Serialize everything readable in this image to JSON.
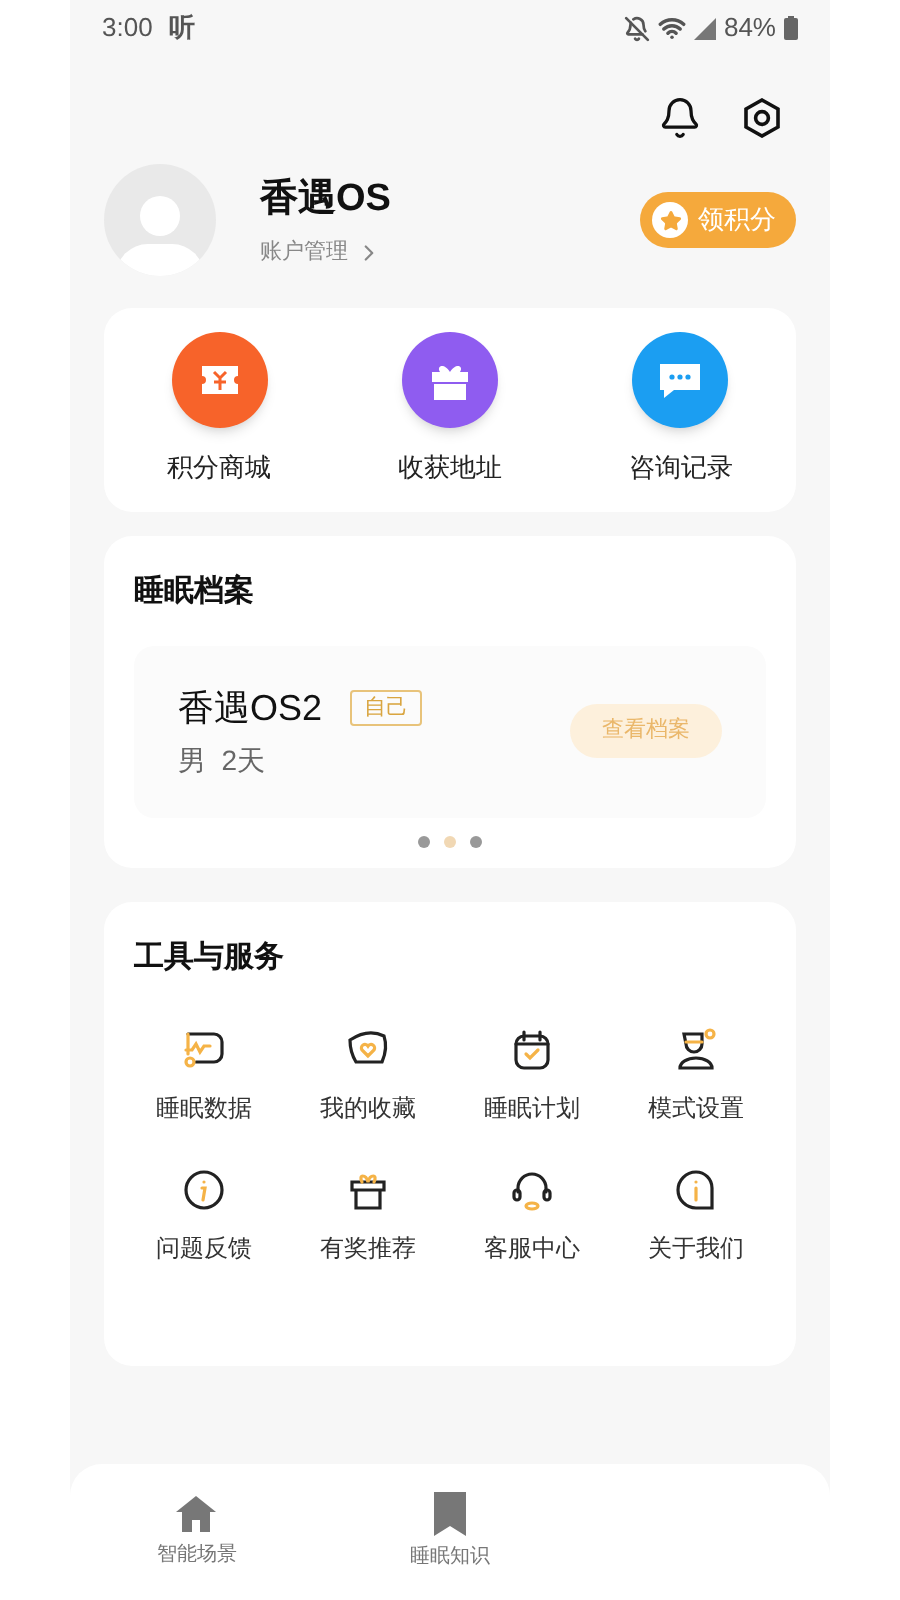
{
  "status_bar": {
    "time": "3:00",
    "app_glyph": "听",
    "battery": "84%"
  },
  "profile": {
    "name": "香遇OS",
    "account_link": "账户管理",
    "points_button": "领积分"
  },
  "shortcuts": [
    {
      "kind": "mall",
      "label": "积分商城"
    },
    {
      "kind": "gift",
      "label": "收获地址"
    },
    {
      "kind": "chat",
      "label": "咨询记录"
    }
  ],
  "sleep_archive": {
    "title": "睡眠档案",
    "profile_name": "香遇OS2",
    "tag": "自己",
    "details": "男  2天",
    "view_button": "查看档案",
    "pages": [
      {
        "selected": false
      },
      {
        "selected": true
      },
      {
        "selected": false
      }
    ]
  },
  "tools": {
    "title": "工具与服务",
    "items": [
      {
        "kind": "data",
        "label": "睡眠数据"
      },
      {
        "kind": "favorite",
        "label": "我的收藏"
      },
      {
        "kind": "plan",
        "label": "睡眠计划"
      },
      {
        "kind": "mode",
        "label": "模式设置"
      },
      {
        "kind": "feedback",
        "label": "问题反馈"
      },
      {
        "kind": "referral",
        "label": "有奖推荐"
      },
      {
        "kind": "service",
        "label": "客服中心"
      },
      {
        "kind": "about",
        "label": "关于我们"
      }
    ]
  },
  "bottom_nav": [
    {
      "kind": "home",
      "label": "智能场景"
    },
    {
      "kind": "bookmark",
      "label": "睡眠知识"
    }
  ]
}
